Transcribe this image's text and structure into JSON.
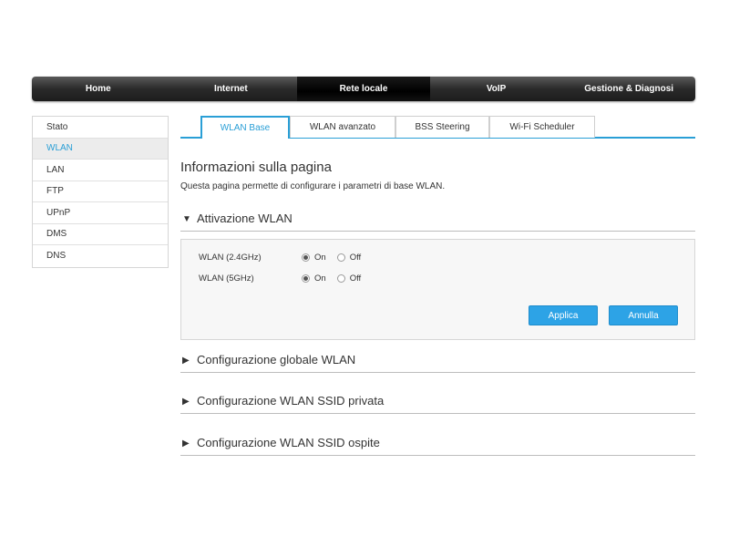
{
  "topnav": {
    "items": [
      {
        "label": "Home"
      },
      {
        "label": "Internet"
      },
      {
        "label": "Rete locale"
      },
      {
        "label": "VoIP"
      },
      {
        "label": "Gestione & Diagnosi"
      }
    ],
    "active_index": 2
  },
  "sidebar": {
    "items": [
      {
        "label": "Stato"
      },
      {
        "label": "WLAN"
      },
      {
        "label": "LAN"
      },
      {
        "label": "FTP"
      },
      {
        "label": "UPnP"
      },
      {
        "label": "DMS"
      },
      {
        "label": "DNS"
      }
    ],
    "active_index": 1
  },
  "tabs": {
    "items": [
      {
        "label": "WLAN Base"
      },
      {
        "label": "WLAN avanzato"
      },
      {
        "label": "BSS Steering"
      },
      {
        "label": "Wi-Fi Scheduler"
      }
    ],
    "active_index": 0
  },
  "page": {
    "title": "Informazioni sulla pagina",
    "description": "Questa pagina permette di configurare i parametri di base WLAN."
  },
  "sections": {
    "activation": {
      "title": "Attivazione WLAN",
      "expanded": true
    },
    "global": {
      "title": "Configurazione globale WLAN",
      "expanded": false
    },
    "private_ssid": {
      "title": "Configurazione WLAN SSID privata",
      "expanded": false
    },
    "guest_ssid": {
      "title": "Configurazione WLAN SSID ospite",
      "expanded": false
    }
  },
  "wlan_activation": {
    "rows": [
      {
        "label": "WLAN (2.4GHz)",
        "value": "On"
      },
      {
        "label": "WLAN (5GHz)",
        "value": "On"
      }
    ],
    "option_on": "On",
    "option_off": "Off",
    "apply_label": "Applica",
    "cancel_label": "Annulla"
  },
  "colors": {
    "accent": "#2a9fd6",
    "button": "#2da3e6",
    "nav_dark": "#1d1d1d"
  },
  "icons": {
    "expanded": "triangle-down-icon",
    "collapsed": "triangle-right-icon"
  }
}
